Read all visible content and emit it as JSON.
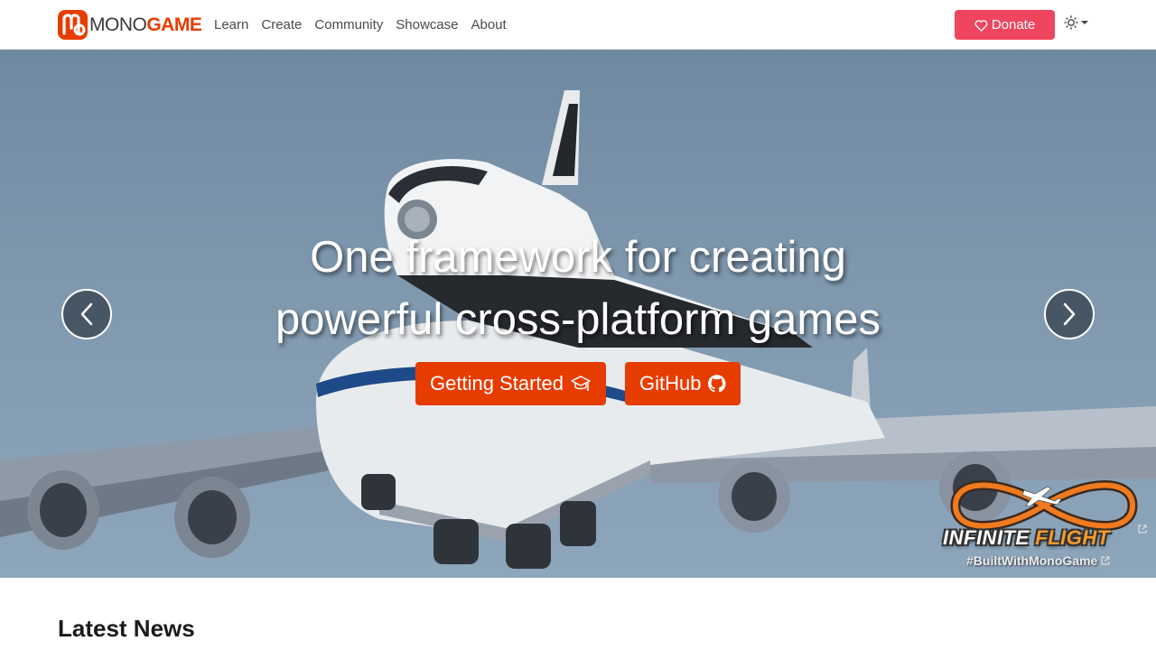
{
  "brand": {
    "mono": "MONO",
    "game": "GAME",
    "accent_color": "#e73c00"
  },
  "nav": {
    "links": [
      "Learn",
      "Create",
      "Community",
      "Showcase",
      "About"
    ],
    "donate_label": "Donate",
    "donate_color": "#f0455f",
    "theme_icon": "sun-icon"
  },
  "hero": {
    "title_line1": "One framework for creating",
    "title_line2": "powerful cross-platform games",
    "getting_started_label": "Getting Started",
    "github_label": "GitHub",
    "button_color": "#e73c00",
    "showcase_name_part1": "INFINITE ",
    "showcase_name_part2": "FLIGHT",
    "showcase_tag": "#BuiltWithMonoGame"
  },
  "news": {
    "heading": "Latest News"
  }
}
